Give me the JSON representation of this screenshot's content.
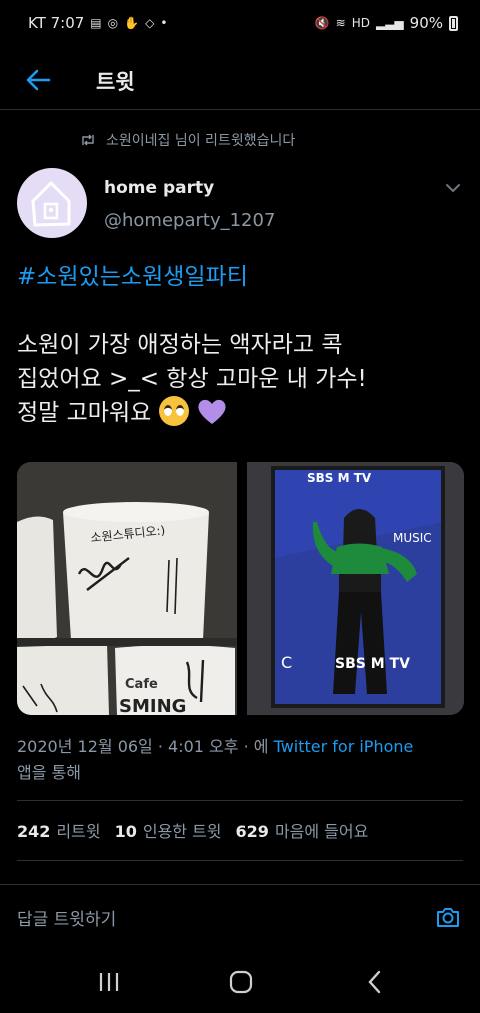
{
  "status_bar": {
    "carrier_time": "KT 7:07",
    "battery": "90%"
  },
  "header": {
    "title": "트윗"
  },
  "retweet_notice": "소원이네집 님이 리트윗했습니다",
  "author": {
    "name": "home party",
    "handle": "@homeparty_1207"
  },
  "tweet": {
    "hashtag": "#소원있는소원생일파티",
    "line1": "소원이 가장 애정하는 액자라고 콕",
    "line2": "집었어요 >_< 항상 고마운 내 가수!",
    "line3": "정말 고마워요"
  },
  "media": {
    "left_photo_text": {
      "cup_scrawl": "소원스튜디오:)",
      "cup_word": "Cafe",
      "cup_brand": "SMING"
    },
    "right_photo_text": {
      "logo_top": "SBS M TV",
      "music": "MUSIC",
      "logo_bottom": "SBS M TV",
      "side_letter": "C"
    }
  },
  "meta": {
    "timestamp": "2020년 12월 06일 · 4:01 오후 · 에",
    "client": "Twitter for iPhone",
    "suffix": "앱을 통해"
  },
  "stats": {
    "retweets_count": "242",
    "retweets_label": "리트윗",
    "quotes_count": "10",
    "quotes_label": "인용한 트윗",
    "likes_count": "629",
    "likes_label": "마음에 들어요"
  },
  "reply": {
    "placeholder": "답글 트윗하기"
  },
  "colors": {
    "accent": "#1d9bf0",
    "background": "#000000",
    "secondary_text": "#8b98a5"
  }
}
